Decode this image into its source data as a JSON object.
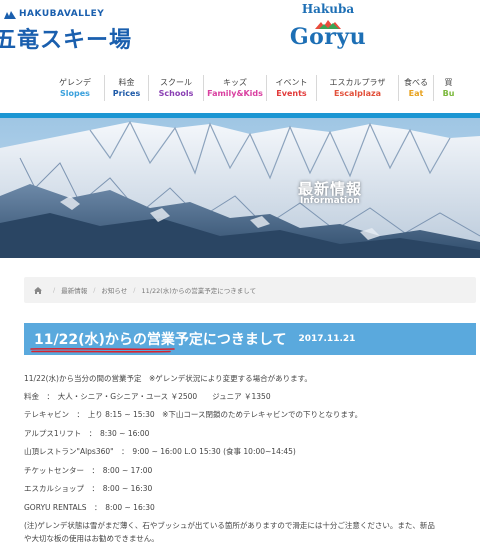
{
  "header": {
    "brand_small": "HAKUBAVALLEY",
    "brand_big": "五竜スキー場",
    "logo_top": "Hakuba",
    "logo_main": "Goryu"
  },
  "nav": [
    {
      "jp": "ゲレンデ",
      "en": "Slopes",
      "color": "#3aa0dc"
    },
    {
      "jp": "料金",
      "en": "Prices",
      "color": "#1e5aa8"
    },
    {
      "jp": "スクール",
      "en": "Schools",
      "color": "#8a3fb3"
    },
    {
      "jp": "キッズ",
      "en": "Family&Kids",
      "color": "#d93fa0"
    },
    {
      "jp": "イベント",
      "en": "Events",
      "color": "#e23b3b"
    },
    {
      "jp": "エスカルプラザ",
      "en": "Escalplaza",
      "color": "#e2503b"
    },
    {
      "jp": "食べる",
      "en": "Eat",
      "color": "#e8a21e"
    },
    {
      "jp": "買",
      "en": "Bu",
      "color": "#7ab83a"
    }
  ],
  "hero": {
    "title": "最新情報",
    "subtitle": "Information"
  },
  "breadcrumb": {
    "items": [
      "最新情報",
      "お知らせ",
      "11/22(水)からの営業予定につきまして"
    ]
  },
  "article": {
    "title": "11/22(水)からの営業予定につきまして",
    "date": "2017.11.21",
    "lines": [
      "11/22(水)から当分の間の営業予定　※ゲレンデ状況により変更する場合があります。",
      "料金　：　大人・シニア・Gシニア・ユース ￥2500　　ジュニア ￥1350",
      "テレキャビン　：　上り 8:15 ~ 15:30　※下山コース閉鎖のためテレキャビンでの下りとなります。",
      "アルプス1リフト　：　8:30 ~ 16:00",
      "山頂レストラン\"Alps360\"　：　9:00 ~ 16:00 L.O 15:30 (食事 10:00~14:45)",
      "チケットセンター　：　8:00 ~ 17:00",
      "エスカルショップ　：　8:00 ~ 16:30",
      "GORYU RENTALS　：　8:00 ~ 16:30",
      "(注)ゲレンデ状態は雪がまだ薄く、石やブッシュが出ている箇所がありますので滑走には十分ご注意ください。また、新品",
      "や大切な板の使用はお勧めできません。"
    ]
  },
  "colors": {
    "brand_blue": "#1a5fae",
    "header_rule": "#1b96d3",
    "title_bar": "#5aa9dd",
    "underline_red": "#d9232e"
  }
}
